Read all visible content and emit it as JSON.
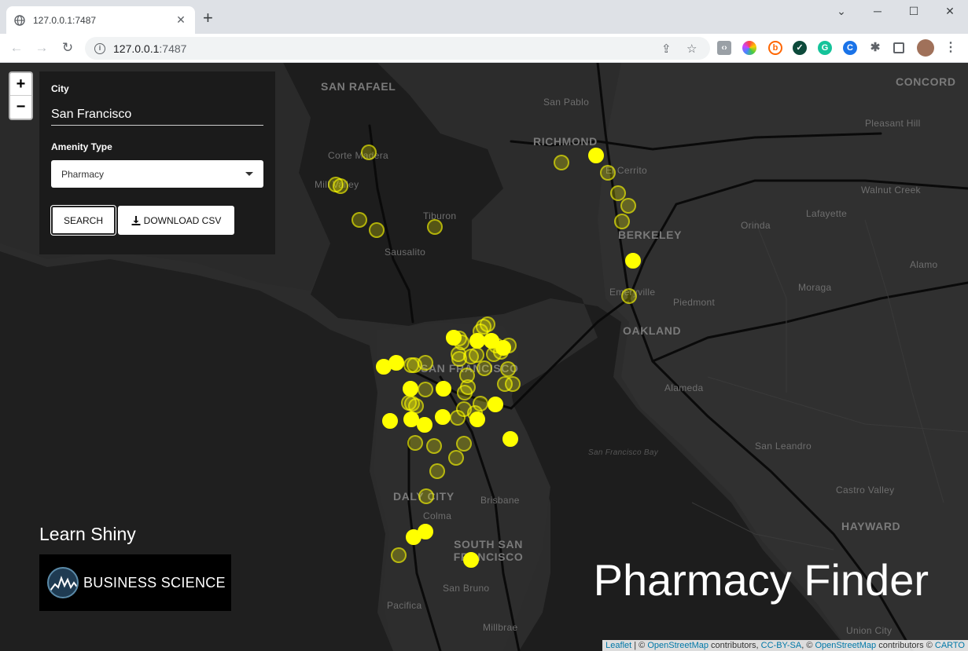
{
  "browser": {
    "tab_title": "127.0.0.1:7487",
    "tab_close": "✕",
    "new_tab": "+",
    "url_host": "127.0.0.1",
    "url_port": ":7487",
    "controls": {
      "minimize": "─",
      "maximize": "☐",
      "close": "✕",
      "menu": "⌄"
    }
  },
  "map": {
    "places": [
      {
        "label": "SAN RAFAEL",
        "size": "big"
      },
      {
        "label": "San Pablo",
        "size": "small"
      },
      {
        "label": "CONCORD",
        "size": "big"
      },
      {
        "label": "RICHMOND",
        "size": "big"
      },
      {
        "label": "Pleasant Hill",
        "size": "small"
      },
      {
        "label": "Corte Madera",
        "size": "small"
      },
      {
        "label": "El Cerrito",
        "size": "small"
      },
      {
        "label": "Walnut Creek",
        "size": "small"
      },
      {
        "label": "Mill Valley",
        "size": "small"
      },
      {
        "label": "Tiburon",
        "size": "small"
      },
      {
        "label": "Lafayette",
        "size": "small"
      },
      {
        "label": "Orinda",
        "size": "small"
      },
      {
        "label": "BERKELEY",
        "size": "big"
      },
      {
        "label": "Sausalito",
        "size": "small"
      },
      {
        "label": "Alamo",
        "size": "small"
      },
      {
        "label": "Emeryville",
        "size": "small"
      },
      {
        "label": "Moraga",
        "size": "small"
      },
      {
        "label": "Piedmont",
        "size": "small"
      },
      {
        "label": "OAKLAND",
        "size": "big"
      },
      {
        "label": "SAN FRANCISCO",
        "size": "big"
      },
      {
        "label": "Alameda",
        "size": "small"
      },
      {
        "label": "San Leandro",
        "size": "small"
      },
      {
        "label": "Castro Valley",
        "size": "small"
      },
      {
        "label": "DALY CITY",
        "size": "big"
      },
      {
        "label": "Brisbane",
        "size": "small"
      },
      {
        "label": "Colma",
        "size": "small"
      },
      {
        "label": "HAYWARD",
        "size": "big"
      },
      {
        "label": "SOUTH SAN FRANCISCO",
        "size": "big"
      },
      {
        "label": "San Bruno",
        "size": "small"
      },
      {
        "label": "Pacifica",
        "size": "small"
      },
      {
        "label": "Millbrae",
        "size": "small"
      },
      {
        "label": "Union City",
        "size": "small"
      }
    ],
    "water_label": "San Francisco Bay",
    "zoom_in": "+",
    "zoom_out": "−",
    "attribution": {
      "leaflet": "Leaflet",
      "sep1": " | © ",
      "osm1": "OpenStreetMap",
      "text1": " contributors, ",
      "ccbysa": "CC-BY-SA",
      "text2": ", © ",
      "osm2": "OpenStreetMap",
      "text3": " contributors © ",
      "carto": "CARTO"
    },
    "marker_color": "#ffff00"
  },
  "panel": {
    "city_label": "City",
    "city_value": "San Francisco",
    "amenity_label": "Amenity Type",
    "amenity_value": "Pharmacy",
    "search_button": "SEARCH",
    "download_button": "DOWNLOAD CSV"
  },
  "learn_label": "Learn Shiny",
  "brand_text": "BUSINESS SCIENCE",
  "app_title": "Pharmacy Finder"
}
